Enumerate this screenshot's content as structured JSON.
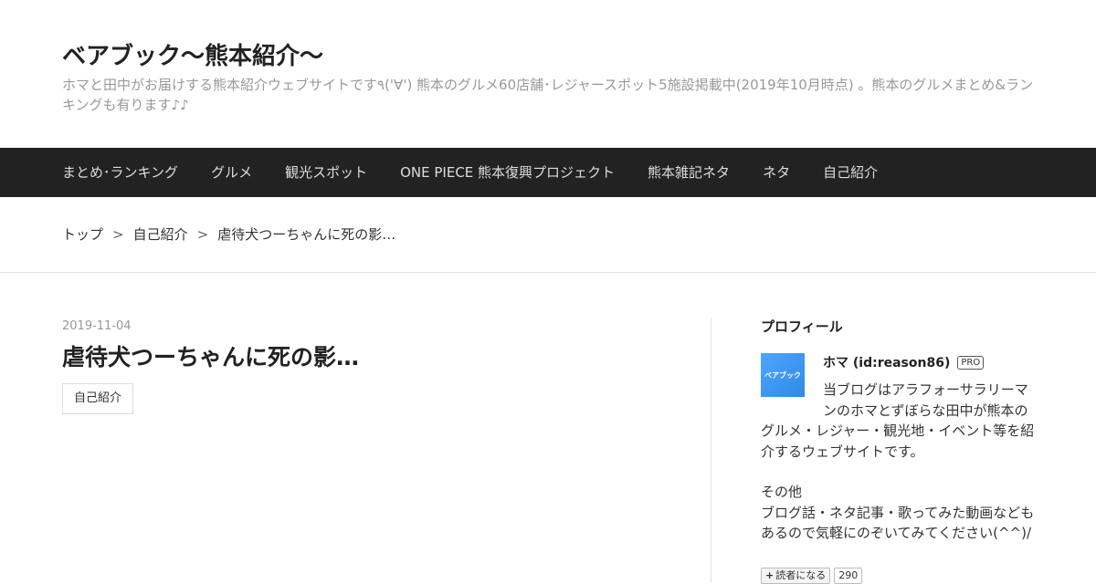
{
  "header": {
    "title": "ベアブック～熊本紹介～",
    "description": "ホマと田中がお届けする熊本紹介ウェブサイトです٩('∀')  熊本のグルメ60店舗･レジャースポット5施設掲載中(2019年10月時点) 。熊本のグルメまとめ&ランキングも有ります♪♪"
  },
  "nav": {
    "items": [
      "まとめ･ランキング",
      "グルメ",
      "観光スポット",
      "ONE PIECE 熊本復興プロジェクト",
      "熊本雑記ネタ",
      "ネタ",
      "自己紹介"
    ]
  },
  "breadcrumb": {
    "items": [
      "トップ",
      "自己紹介",
      "虐待犬つーちゃんに死の影…"
    ],
    "separator": ">"
  },
  "entry": {
    "date": "2019-11-04",
    "title": "虐待犬つーちゃんに死の影…",
    "category": "自己紹介"
  },
  "sidebar": {
    "module_title": "プロフィール",
    "avatar_text": "ベアブック",
    "name": "ホマ (id:reason86)",
    "badge": "PRO",
    "description": "当ブログはアラフォーサラリーマンのホマとずぼらな田中が熊本のグルメ・レジャー・観光地・イベント等を紹介するウェブサイトです。",
    "description2_line1": "その他",
    "description2_line2": "ブログ話・ネタ記事・歌ってみた動画なども",
    "description2_line3": "あるので気軽にのぞいてみてください(^^)/",
    "reader_label": "読者になる",
    "reader_count": "290"
  },
  "colors": {
    "nav_bg": "#222222",
    "avatar_bg": "#3d9bf0"
  }
}
